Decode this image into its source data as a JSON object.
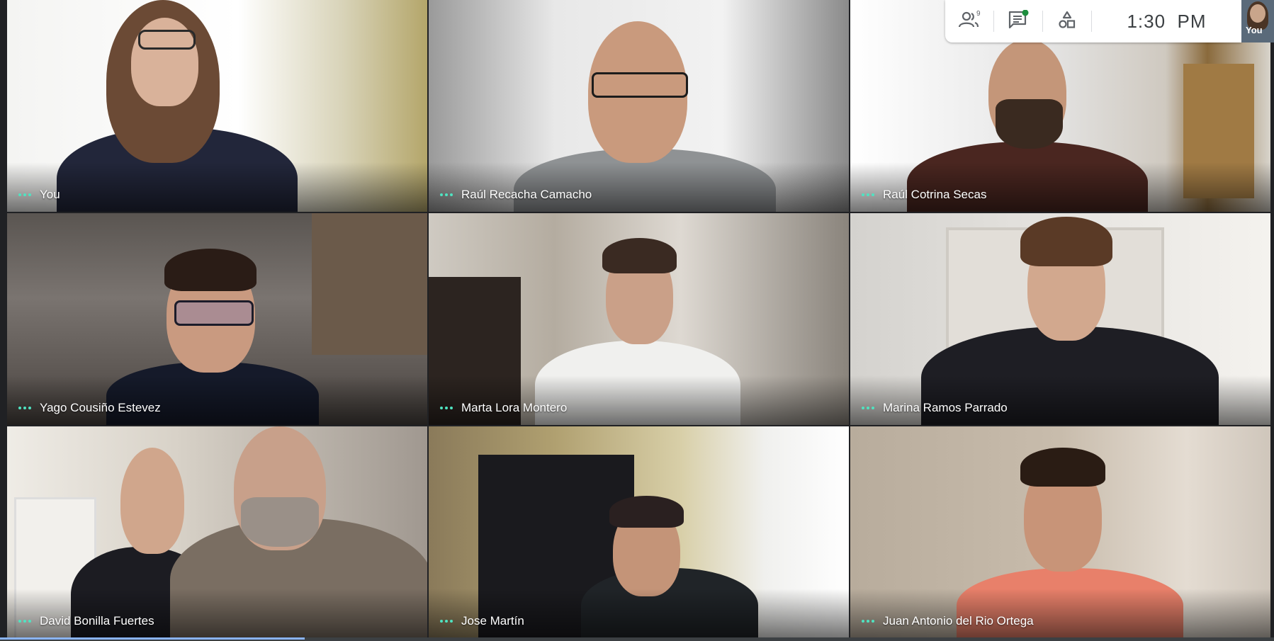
{
  "toolbar": {
    "participants_icon": "people-icon",
    "participant_count": "9",
    "chat_icon": "chat-icon",
    "activities_icon": "shapes-icon",
    "time": "1:30  PM",
    "self_view_label": "You"
  },
  "participants": [
    {
      "name": "You"
    },
    {
      "name": "Raúl Recacha Camacho"
    },
    {
      "name": "Raúl Cotrina Secas"
    },
    {
      "name": "Yago Cousiño Estevez"
    },
    {
      "name": "Marta Lora Montero"
    },
    {
      "name": "Marina Ramos Parrado"
    },
    {
      "name": "David Bonilla Fuertes"
    },
    {
      "name": "Jose Martín"
    },
    {
      "name": "Juan Antonio del Rio Ortega"
    }
  ],
  "colors": {
    "accent_dots": "#4fe3c1",
    "chat_badge": "#1e8e3e",
    "background": "#202124"
  }
}
